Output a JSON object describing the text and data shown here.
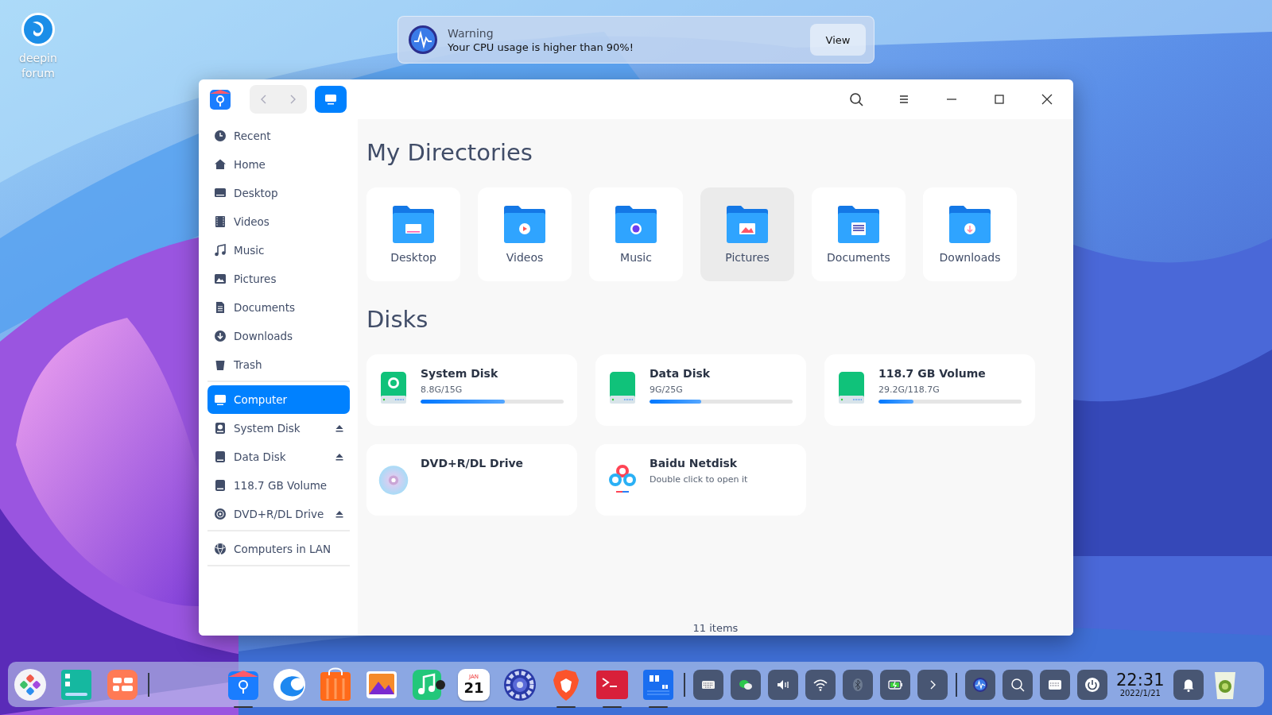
{
  "desktop_icons": [
    {
      "label": "deepin forum"
    }
  ],
  "notification": {
    "title": "Warning",
    "message": "Your CPU usage is higher than 90%!",
    "button": "View"
  },
  "window": {
    "sidebar": {
      "groups": [
        {
          "items": [
            {
              "label": "Recent",
              "selected": false,
              "ejectable": false
            },
            {
              "label": "Home",
              "selected": false,
              "ejectable": false
            },
            {
              "label": "Desktop",
              "selected": false,
              "ejectable": false
            },
            {
              "label": "Videos",
              "selected": false,
              "ejectable": false
            },
            {
              "label": "Music",
              "selected": false,
              "ejectable": false
            },
            {
              "label": "Pictures",
              "selected": false,
              "ejectable": false
            },
            {
              "label": "Documents",
              "selected": false,
              "ejectable": false
            },
            {
              "label": "Downloads",
              "selected": false,
              "ejectable": false
            },
            {
              "label": "Trash",
              "selected": false,
              "ejectable": false
            }
          ]
        },
        {
          "items": [
            {
              "label": "Computer",
              "selected": true,
              "ejectable": false
            },
            {
              "label": "System Disk",
              "selected": false,
              "ejectable": true
            },
            {
              "label": "Data Disk",
              "selected": false,
              "ejectable": true
            },
            {
              "label": "118.7 GB Volume",
              "selected": false,
              "ejectable": false
            },
            {
              "label": "DVD+R/DL Drive",
              "selected": false,
              "ejectable": true
            }
          ]
        },
        {
          "items": [
            {
              "label": "Computers in LAN",
              "selected": false,
              "ejectable": false
            }
          ]
        }
      ]
    },
    "directories": {
      "title": "My Directories",
      "items": [
        {
          "label": "Desktop",
          "selected": false
        },
        {
          "label": "Videos",
          "selected": false
        },
        {
          "label": "Music",
          "selected": false
        },
        {
          "label": "Pictures",
          "selected": true
        },
        {
          "label": "Documents",
          "selected": false
        },
        {
          "label": "Downloads",
          "selected": false
        }
      ]
    },
    "disks": {
      "title": "Disks",
      "items": [
        {
          "kind": "disk",
          "name": "System Disk",
          "usage": "8.8G/15G",
          "level": 0.587
        },
        {
          "kind": "disk",
          "name": "Data Disk",
          "usage": "9G/25G",
          "level": 0.36
        },
        {
          "kind": "disk",
          "name": "118.7 GB Volume",
          "usage": "29.2G/118.7G",
          "level": 0.246
        },
        {
          "kind": "optical",
          "name": "DVD+R/DL Drive"
        },
        {
          "kind": "netdisk",
          "name": "Baidu Netdisk",
          "subtitle": "Double click to open it"
        }
      ]
    },
    "status_bar": "11 items"
  },
  "dock": {
    "apps": [
      {
        "running": false
      },
      {
        "running": false
      },
      {
        "running": false
      },
      {
        "running": true
      },
      {
        "running": false
      },
      {
        "running": false
      },
      {
        "running": false
      },
      {
        "running": false
      },
      {
        "running": false,
        "month": "JAN",
        "day": "21"
      },
      {
        "running": false
      },
      {
        "running": true
      },
      {
        "running": true
      },
      {
        "running": true
      }
    ],
    "clock": {
      "time": "22:31",
      "date": "2022/1/21"
    }
  }
}
